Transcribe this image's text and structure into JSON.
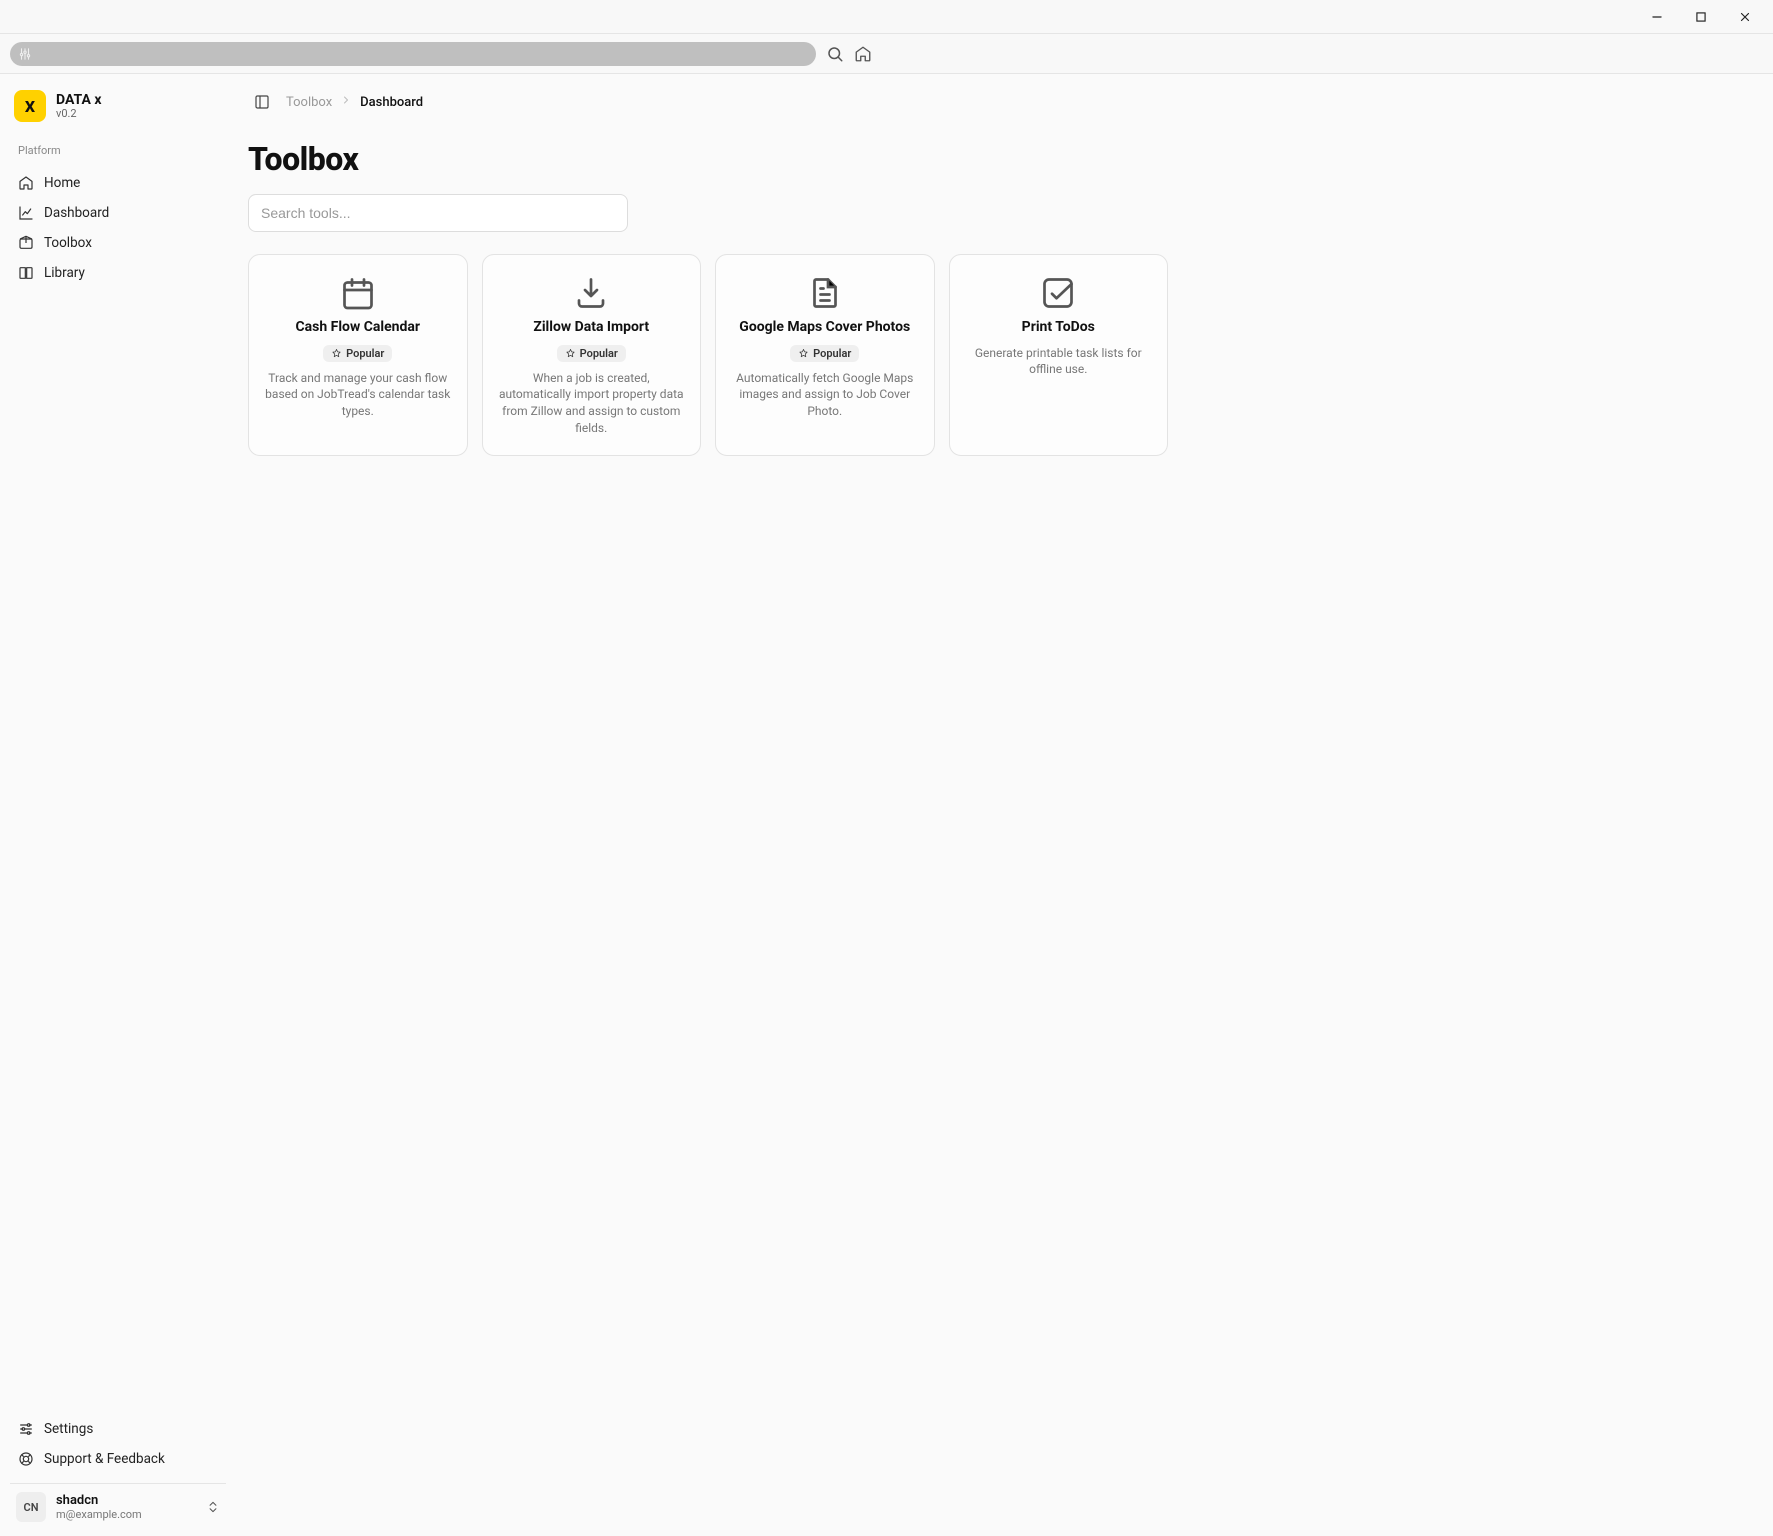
{
  "brand": {
    "name": "DATA x",
    "version": "v0.2",
    "logo_letter": "X"
  },
  "sidebar": {
    "section_label": "Platform",
    "items": [
      {
        "name": "home",
        "label": "Home"
      },
      {
        "name": "dashboard",
        "label": "Dashboard"
      },
      {
        "name": "toolbox",
        "label": "Toolbox"
      },
      {
        "name": "library",
        "label": "Library"
      }
    ],
    "footer_items": [
      {
        "name": "settings",
        "label": "Settings"
      },
      {
        "name": "support",
        "label": "Support & Feedback"
      }
    ]
  },
  "user": {
    "initials": "CN",
    "name": "shadcn",
    "email": "m@example.com"
  },
  "breadcrumbs": [
    {
      "label": "Toolbox",
      "active": false
    },
    {
      "label": "Dashboard",
      "active": true
    }
  ],
  "page": {
    "title": "Toolbox"
  },
  "search": {
    "placeholder": "Search tools..."
  },
  "badge_label": "Popular",
  "tools": [
    {
      "name": "cash-flow-calendar",
      "icon": "calendar",
      "title": "Cash Flow Calendar",
      "popular": true,
      "description": "Track and manage your cash flow based on JobTread's calendar task types."
    },
    {
      "name": "zillow-data-import",
      "icon": "download",
      "title": "Zillow Data Import",
      "popular": true,
      "description": "When a job is created, automatically import property data from Zillow and assign to custom fields."
    },
    {
      "name": "google-maps-cover-photos",
      "icon": "file-text",
      "title": "Google Maps Cover Photos",
      "popular": true,
      "description": "Automatically fetch Google Maps images and assign to Job Cover Photo."
    },
    {
      "name": "print-todos",
      "icon": "check-square",
      "title": "Print ToDos",
      "popular": false,
      "description": "Generate printable task lists for offline use."
    }
  ]
}
